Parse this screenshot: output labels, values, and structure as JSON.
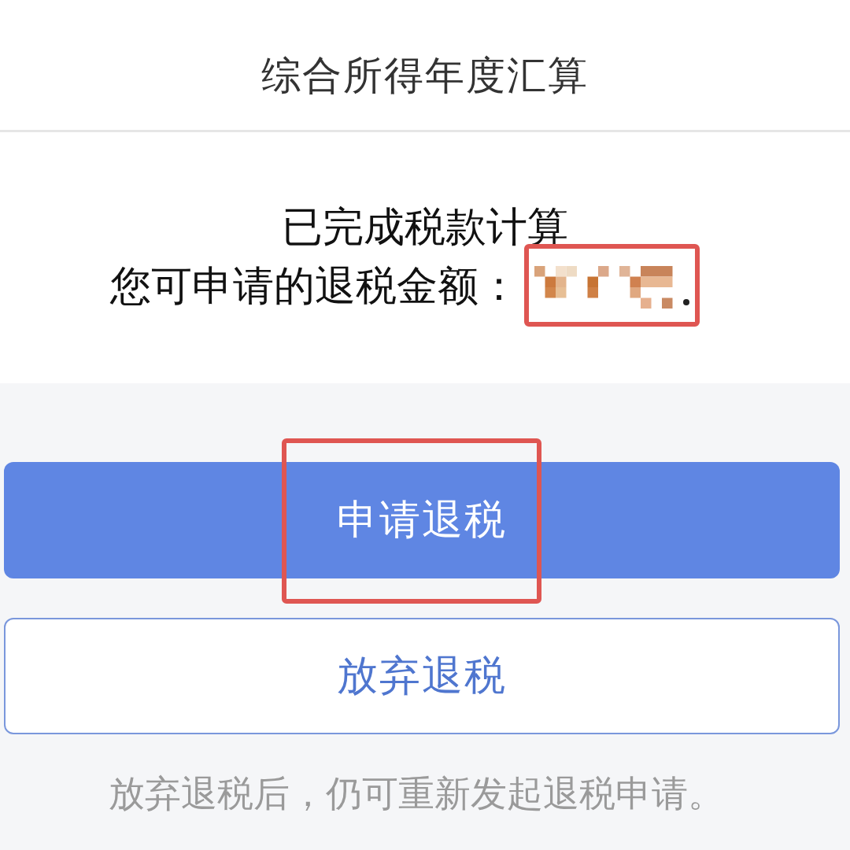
{
  "header": {
    "title": "综合所得年度汇算"
  },
  "result": {
    "status": "已完成税款计算",
    "refund_label": "您可申请的退税金额：",
    "amount_highlighted": true
  },
  "buttons": [
    {
      "label": "申请退税",
      "kind": "primary",
      "highlighted": true
    },
    {
      "label": "放弃退税",
      "kind": "outline",
      "highlighted": false
    }
  ],
  "note": "放弃退税后，仍可重新发起退税申请。"
}
